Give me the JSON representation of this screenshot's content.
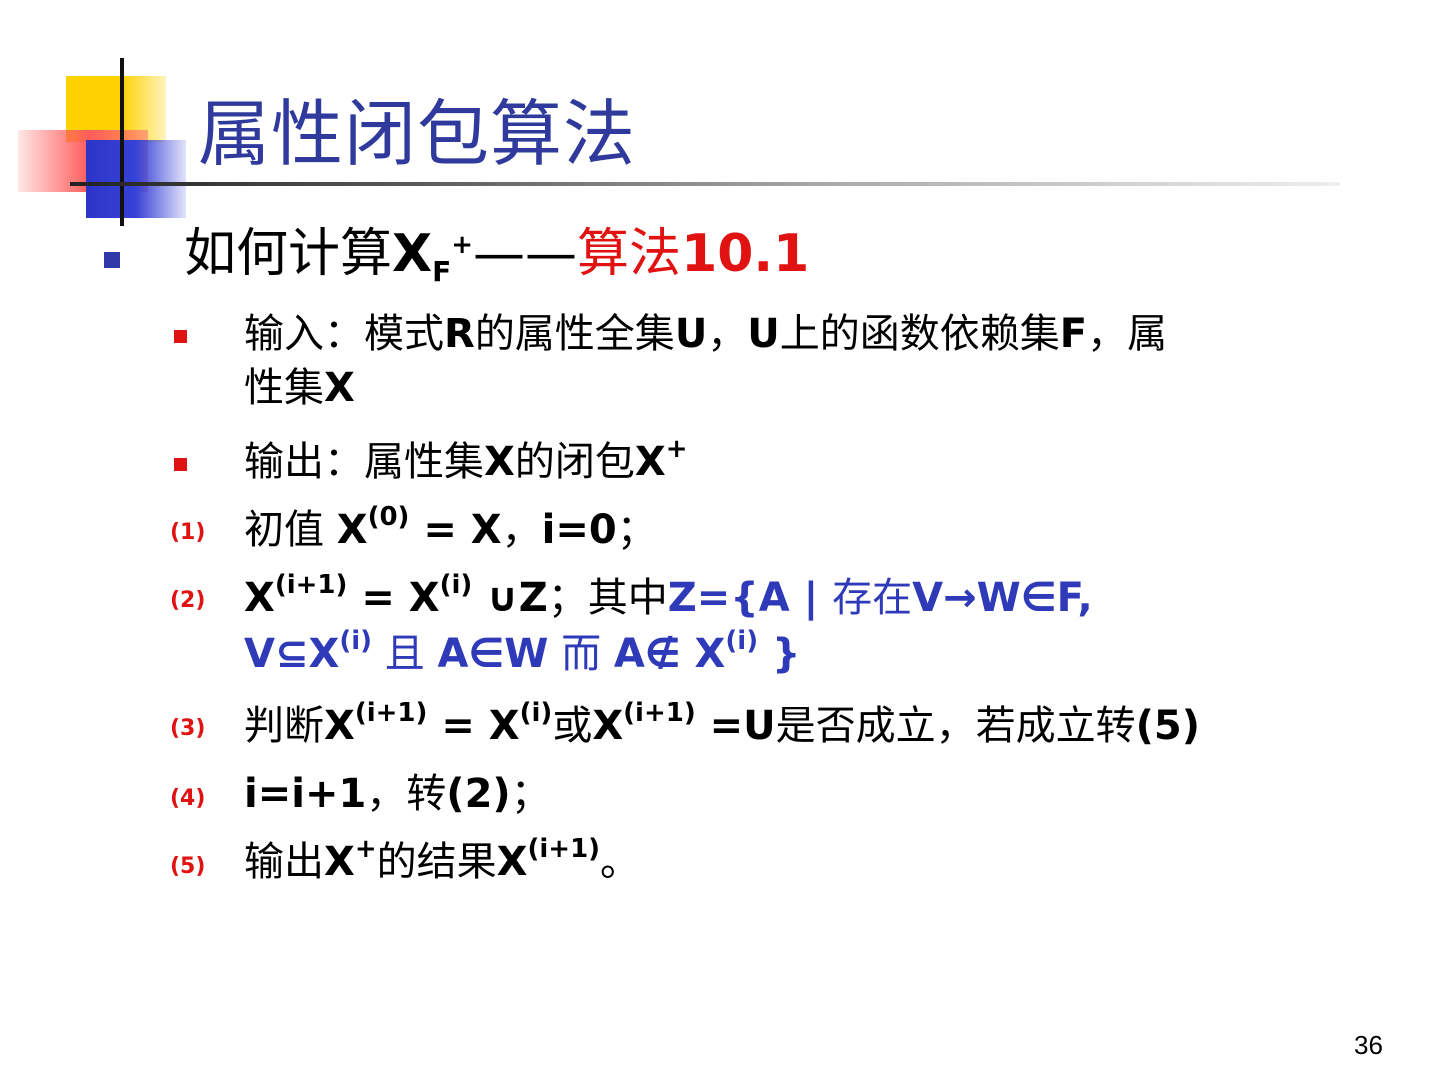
{
  "slide": {
    "title": "属性闭包算法",
    "heading": {
      "lead": "如何计算",
      "x": "X",
      "sub": "F",
      "sup": "+",
      "dash": "——",
      "algo": "算法",
      "algo_num": "10.1"
    },
    "input": {
      "p1": "输入：模式",
      "r": "R",
      "p2": "的属性全集",
      "u1": "U",
      "p3": "，",
      "u2": "U",
      "p4": "上的函数依赖集",
      "f": "F",
      "p5": "，属",
      "p6": "性集",
      "x": "X"
    },
    "output": {
      "p1": "输出：属性集",
      "x1": "X",
      "p2": "的闭包",
      "x2": "X",
      "sup": "+"
    },
    "steps": {
      "s1": {
        "num": "(1)",
        "t1": "初值 ",
        "x": "X",
        "sup": "(0)",
        "t2": " = X",
        "t3": "，",
        "t4": "i=0",
        "t5": "；"
      },
      "s2": {
        "num": "(2)",
        "x1": "X",
        "sup1": "(i+1)",
        "eq": " = X",
        "sup2": "(i)",
        "union": " ∪Z",
        "semi": "；其中",
        "z": "Z={A | ",
        "exist": "存在",
        "vw": "V→W∈F,",
        "l2a": "V⊆X",
        "sup3": "(i)",
        "and": " 且 ",
        "aw": "A∈W",
        "but": " 而 ",
        "anot": "A∉ X",
        "sup4": "(i)",
        "close": " }"
      },
      "s3": {
        "num": "(3)",
        "t1": "判断",
        "x1": "X",
        "sup1": "(i+1)",
        "eq": " = X",
        "sup2": "(i)",
        "or": "或",
        "x2": "X",
        "sup3": "(i+1)",
        "eqU": " =U",
        "t2": "是否成立，若成立转",
        "goto": "(5)"
      },
      "s4": {
        "num": "(4)",
        "t1": "i=i+1",
        "t2": "，转",
        "t3": "(2)",
        "t4": "；"
      },
      "s5": {
        "num": "(5)",
        "t1": "输出",
        "x1": "X",
        "sup1": "+",
        "t2": "的结果",
        "x2": "X",
        "sup2": "(i+1)",
        "t3": "。"
      }
    },
    "page_number": "36"
  }
}
